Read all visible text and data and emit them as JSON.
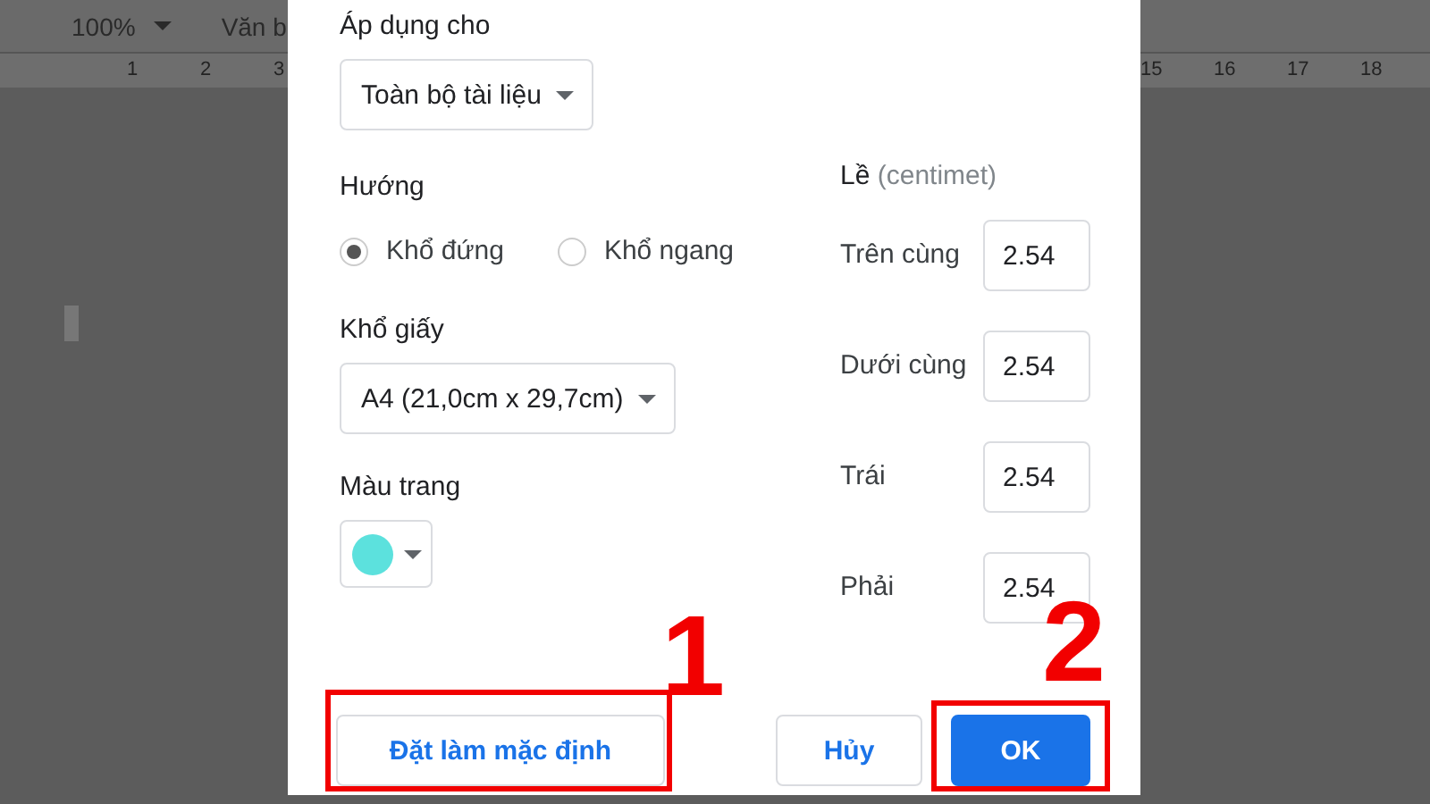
{
  "toolbar": {
    "zoom": "100%",
    "style": "Văn b"
  },
  "ruler": {
    "left_ticks": [
      "1",
      "2",
      "3"
    ],
    "right_ticks": [
      "15",
      "16",
      "17",
      "18"
    ]
  },
  "dialog": {
    "apply_to": {
      "label": "Áp dụng cho",
      "value": "Toàn bộ tài liệu"
    },
    "orientation": {
      "label": "Hướng",
      "options": [
        {
          "label": "Khổ đứng",
          "selected": true
        },
        {
          "label": "Khổ ngang",
          "selected": false
        }
      ]
    },
    "paper_size": {
      "label": "Khổ giấy",
      "value": "A4 (21,0cm x 29,7cm)"
    },
    "page_color": {
      "label": "Màu trang",
      "color": "#5ce1dd"
    },
    "margins": {
      "label": "Lề",
      "unit": "(centimet)",
      "fields": [
        {
          "label": "Trên cùng",
          "value": "2.54"
        },
        {
          "label": "Dưới cùng",
          "value": "2.54"
        },
        {
          "label": "Trái",
          "value": "2.54"
        },
        {
          "label": "Phải",
          "value": "2.54"
        }
      ]
    },
    "buttons": [
      {
        "label": "Đặt làm mặc định",
        "kind": "default"
      },
      {
        "label": "Hủy",
        "kind": "cancel"
      },
      {
        "label": "OK",
        "kind": "primary"
      }
    ]
  },
  "annotations": [
    "1",
    "2"
  ]
}
